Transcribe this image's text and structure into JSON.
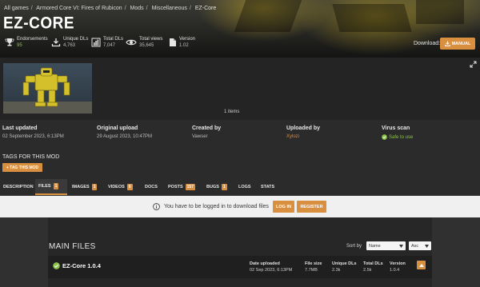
{
  "breadcrumb": [
    "All games",
    "Armored Core VI: Fires of Rubicon",
    "Mods",
    "Miscellaneous",
    "EZ-Core"
  ],
  "mod_title": "EZ-CORE",
  "stats": {
    "endorsements": {
      "label": "Endorsements",
      "value": "95"
    },
    "unique_dls": {
      "label": "Unique DLs",
      "value": "4,763"
    },
    "total_dls": {
      "label": "Total DLs",
      "value": "7,047"
    },
    "total_views": {
      "label": "Total views",
      "value": "35,645"
    },
    "version": {
      "label": "Version",
      "value": "1.02"
    }
  },
  "download": {
    "label": "Download:",
    "manual_button": "MANUAL"
  },
  "gallery": {
    "items_count": "1 items"
  },
  "info": {
    "last_updated": {
      "label": "Last updated",
      "value": "02 September 2023,  6:13PM"
    },
    "original_upload": {
      "label": "Original upload",
      "value": "29 August 2023,  10:47PM"
    },
    "created_by": {
      "label": "Created by",
      "value": "Vawser"
    },
    "uploaded_by": {
      "label": "Uploaded by",
      "value": "Xylozi"
    },
    "virus_scan": {
      "label": "Virus scan",
      "value": "Safe to use"
    }
  },
  "tags": {
    "title": "TAGS FOR THIS MOD",
    "button": "+ TAG THIS MOD"
  },
  "tabs": [
    {
      "label": "DESCRIPTION",
      "badge": null
    },
    {
      "label": "FILES",
      "badge": "1"
    },
    {
      "label": "IMAGES",
      "badge": "1"
    },
    {
      "label": "VIDEOS",
      "badge": "0"
    },
    {
      "label": "DOCS",
      "badge": null
    },
    {
      "label": "POSTS",
      "badge": "157"
    },
    {
      "label": "BUGS",
      "badge": "1"
    },
    {
      "label": "LOGS",
      "badge": null
    },
    {
      "label": "STATS",
      "badge": null
    }
  ],
  "login_bar": {
    "message": "You have to be logged in to download files",
    "login_button": "LOG IN",
    "register_button": "REGISTER"
  },
  "files": {
    "section_title": "MAIN FILES",
    "sort_label": "Sort by",
    "sort_field": "Name",
    "sort_order": "Asc",
    "file": {
      "name": "EZ-Core 1.0.4",
      "date_label": "Date uploaded",
      "date_value": "02 Sep 2023, 6:13PM",
      "size_label": "File size",
      "size_value": "7.7MB",
      "unique_label": "Unique DLs",
      "unique_value": "2.3k",
      "total_label": "Total DLs",
      "total_value": "2.5k",
      "version_label": "Version",
      "version_value": "1.0.4"
    }
  },
  "colors": {
    "accent": "#d98f40",
    "safe": "#8bc34a",
    "background": "#2d2d2d",
    "login_bar": "#f0f0f0"
  }
}
